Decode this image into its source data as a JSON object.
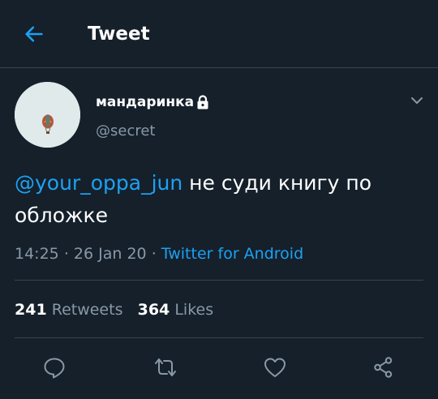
{
  "header": {
    "title": "Tweet",
    "back_icon": "arrow-left-icon"
  },
  "tweet": {
    "display_name": "мандаринка",
    "protected_icon": "lock-icon",
    "handle": "@secret",
    "mention": "@your_oppa_jun",
    "text": " не суди книгу по обложке",
    "time": "14:25",
    "date": "26 Jan 20",
    "source": "Twitter for Android",
    "separator": "·"
  },
  "stats": {
    "retweets_count": "241",
    "retweets_label": "Retweets",
    "likes_count": "364",
    "likes_label": "Likes"
  },
  "actions": [
    "reply-icon",
    "retweet-icon",
    "like-icon",
    "share-icon"
  ],
  "colors": {
    "background": "#15202b",
    "accent": "#1da1f2",
    "secondary_text": "#8899a6",
    "divider": "#38444d"
  }
}
